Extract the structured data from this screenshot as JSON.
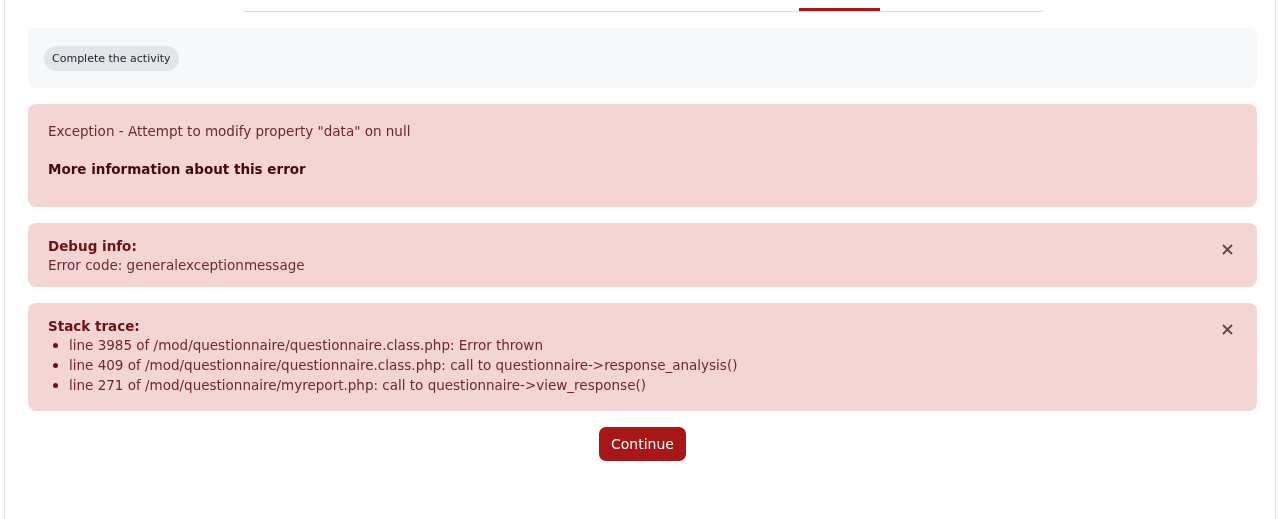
{
  "completion": {
    "badge": "Complete the activity"
  },
  "error": {
    "message": "Exception - Attempt to modify property \"data\" on null",
    "more_info": "More information about this error"
  },
  "debug": {
    "title": "Debug info:",
    "text": "Error code: generalexceptionmessage"
  },
  "stack_trace": {
    "title": "Stack trace:",
    "lines": [
      "line 3985 of /mod/questionnaire/questionnaire.class.php: Error thrown",
      "line 409 of /mod/questionnaire/questionnaire.class.php: call to questionnaire->response_analysis()",
      "line 271 of /mod/questionnaire/myreport.php: call to questionnaire->view_response()"
    ]
  },
  "buttons": [
    "Continue"
  ]
}
